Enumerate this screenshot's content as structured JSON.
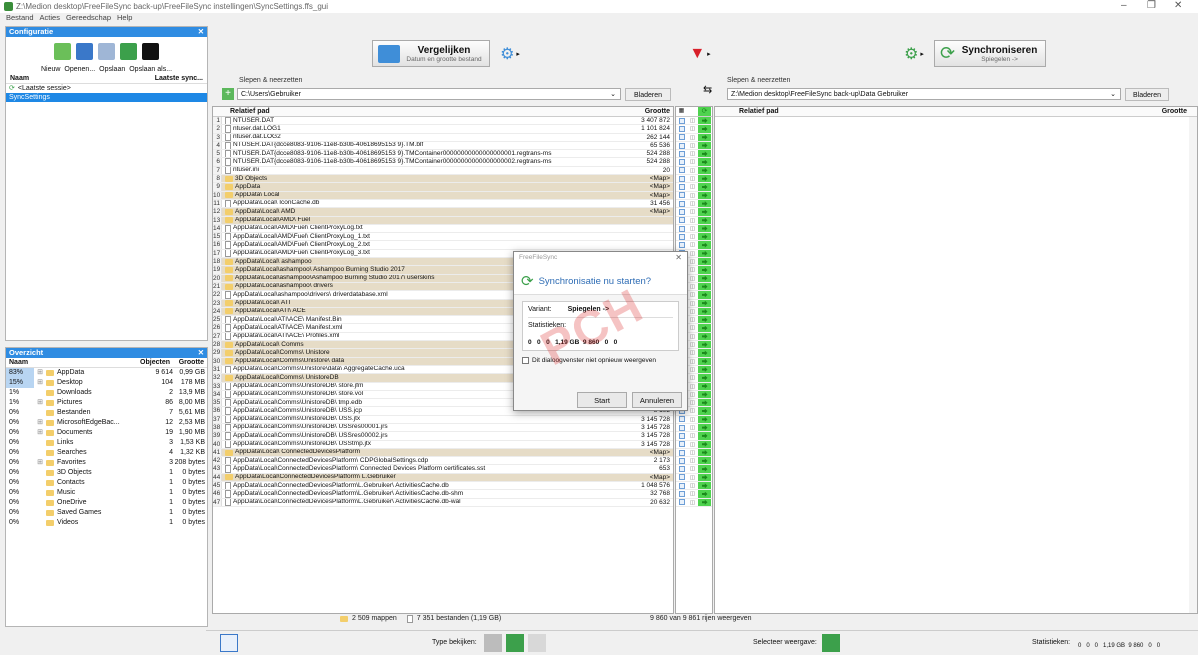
{
  "window": {
    "title": "Z:\\Medion desktop\\FreeFileSync back-up\\FreeFileSync instellingen\\SyncSettings.ffs_gui",
    "minimize": "–",
    "restore": "❐",
    "close": "✕"
  },
  "menu": [
    "Bestand",
    "Acties",
    "Gereedschap",
    "Help"
  ],
  "configuration": {
    "title": "Configuratie",
    "buttons": [
      "Nieuw",
      "Openen...",
      "Opslaan",
      "Opslaan als..."
    ],
    "col_name": "Naam",
    "col_last_sync": "Laatste sync...",
    "items": [
      "<Laatste sessie>",
      "SyncSettings"
    ]
  },
  "overview": {
    "title": "Overzicht",
    "col_name": "Naam",
    "col_objects": "Objecten",
    "col_size": "Grootte",
    "rows": [
      {
        "pct": "83%",
        "expand": "⊞",
        "name": "AppData",
        "objects": "9 614",
        "size": "0,99 GB"
      },
      {
        "pct": "15%",
        "expand": "⊞",
        "name": "Desktop",
        "objects": "104",
        "size": "178 MB"
      },
      {
        "pct": "1%",
        "expand": "",
        "name": "Downloads",
        "objects": "2",
        "size": "13,9 MB"
      },
      {
        "pct": "1%",
        "expand": "⊞",
        "name": "Pictures",
        "objects": "86",
        "size": "8,00 MB"
      },
      {
        "pct": "0%",
        "expand": "",
        "name": "Bestanden",
        "objects": "7",
        "size": "5,61 MB"
      },
      {
        "pct": "0%",
        "expand": "⊞",
        "name": "MicrosoftEdgeBac...",
        "objects": "12",
        "size": "2,53 MB"
      },
      {
        "pct": "0%",
        "expand": "⊞",
        "name": "Documents",
        "objects": "19",
        "size": "1,90 MB"
      },
      {
        "pct": "0%",
        "expand": "",
        "name": "Links",
        "objects": "3",
        "size": "1,53 KB"
      },
      {
        "pct": "0%",
        "expand": "",
        "name": "Searches",
        "objects": "4",
        "size": "1,32 KB"
      },
      {
        "pct": "0%",
        "expand": "⊞",
        "name": "Favorites",
        "objects": "3",
        "size": "208 bytes"
      },
      {
        "pct": "0%",
        "expand": "",
        "name": "3D Objects",
        "objects": "1",
        "size": "0 bytes"
      },
      {
        "pct": "0%",
        "expand": "",
        "name": "Contacts",
        "objects": "1",
        "size": "0 bytes"
      },
      {
        "pct": "0%",
        "expand": "",
        "name": "Music",
        "objects": "1",
        "size": "0 bytes"
      },
      {
        "pct": "0%",
        "expand": "",
        "name": "OneDrive",
        "objects": "1",
        "size": "0 bytes"
      },
      {
        "pct": "0%",
        "expand": "",
        "name": "Saved Games",
        "objects": "1",
        "size": "0 bytes"
      },
      {
        "pct": "0%",
        "expand": "",
        "name": "Videos",
        "objects": "1",
        "size": "0 bytes"
      }
    ]
  },
  "toolbar": {
    "compare_label": "Vergelijken",
    "compare_sub": "Datum en grootte bestand",
    "sync_label": "Synchroniseren",
    "sync_sub": "Spiegelen ->"
  },
  "left": {
    "drag_label": "Slepen & neerzetten",
    "path": "C:\\Users\\Gebruiker",
    "browse": "Bladeren",
    "col_path": "Relatief pad",
    "col_size": "Grootte"
  },
  "right": {
    "drag_label": "Slepen & neerzetten",
    "path": "Z:\\Medion desktop\\FreeFileSync back-up\\Data Gebruiker",
    "browse": "Bladeren",
    "col_path": "Relatief pad",
    "col_size": "Grootte"
  },
  "rows": [
    {
      "n": "1",
      "p": "NTUSER.DAT",
      "s": "3 407 872",
      "f": false
    },
    {
      "n": "2",
      "p": "ntuser.dat.LOG1",
      "s": "1 101 824",
      "f": false
    },
    {
      "n": "3",
      "p": "ntuser.dat.LOG2",
      "s": "262 144",
      "f": false
    },
    {
      "n": "4",
      "p": "NTUSER.DAT{dcce8083-9106-11e8-b30b-40618695153 9}.TM.blf",
      "s": "65 536",
      "f": false
    },
    {
      "n": "5",
      "p": "NTUSER.DAT{dcce8083-9106-11e8-b30b-40618695153 9}.TMContainer00000000000000000001.regtrans-ms",
      "s": "524 288",
      "f": false
    },
    {
      "n": "6",
      "p": "NTUSER.DAT{dcce8083-9106-11e8-b30b-40618695153 9}.TMContainer00000000000000000002.regtrans-ms",
      "s": "524 288",
      "f": false
    },
    {
      "n": "7",
      "p": "ntuser.ini",
      "s": "20",
      "f": false
    },
    {
      "n": "8",
      "p": "3D Objects",
      "s": "<Map>",
      "f": true
    },
    {
      "n": "9",
      "p": "AppData",
      "s": "<Map>",
      "f": true
    },
    {
      "n": "10",
      "p": "AppData\\  Local",
      "s": "<Map>",
      "f": true
    },
    {
      "n": "11",
      "p": "AppData\\Local\\  IconCache.db",
      "s": "31 456",
      "f": false
    },
    {
      "n": "12",
      "p": "AppData\\Local\\  AMD",
      "s": "<Map>",
      "f": true
    },
    {
      "n": "13",
      "p": "AppData\\Local\\AMD\\  Fuel",
      "s": "",
      "f": true
    },
    {
      "n": "14",
      "p": "AppData\\Local\\AMD\\Fuel\\  ClientProxyLog.txt",
      "s": "",
      "f": false
    },
    {
      "n": "15",
      "p": "AppData\\Local\\AMD\\Fuel\\  ClientProxyLog_1.txt",
      "s": "",
      "f": false
    },
    {
      "n": "16",
      "p": "AppData\\Local\\AMD\\Fuel\\  ClientProxyLog_2.txt",
      "s": "",
      "f": false
    },
    {
      "n": "17",
      "p": "AppData\\Local\\AMD\\Fuel\\  ClientProxyLog_3.txt",
      "s": "",
      "f": false
    },
    {
      "n": "18",
      "p": "AppData\\Local\\  ashampoo",
      "s": "",
      "f": true
    },
    {
      "n": "19",
      "p": "AppData\\Local\\ashampoo\\  Ashampoo Burning Studio 2017",
      "s": "",
      "f": true
    },
    {
      "n": "20",
      "p": "AppData\\Local\\ashampoo\\Ashampoo Burning Studio 2017\\  userskins",
      "s": "",
      "f": true
    },
    {
      "n": "21",
      "p": "AppData\\Local\\ashampoo\\  drivers",
      "s": "",
      "f": true
    },
    {
      "n": "22",
      "p": "AppData\\Local\\ashampoo\\drivers\\  driverdatabase.xml",
      "s": "",
      "f": false
    },
    {
      "n": "23",
      "p": "AppData\\Local\\  ATI",
      "s": "",
      "f": true
    },
    {
      "n": "24",
      "p": "AppData\\Local\\ATI\\  ACE",
      "s": "",
      "f": true
    },
    {
      "n": "25",
      "p": "AppData\\Local\\ATI\\ACE\\  Manifest.Bin",
      "s": "",
      "f": false
    },
    {
      "n": "26",
      "p": "AppData\\Local\\ATI\\ACE\\  Manifest.xml",
      "s": "",
      "f": false
    },
    {
      "n": "27",
      "p": "AppData\\Local\\ATI\\ACE\\  Profiles.xml",
      "s": "",
      "f": false
    },
    {
      "n": "28",
      "p": "AppData\\Local\\  Comms",
      "s": "",
      "f": true
    },
    {
      "n": "29",
      "p": "AppData\\Local\\Comms\\  Unistore",
      "s": "<Map>",
      "f": true
    },
    {
      "n": "30",
      "p": "AppData\\Local\\Comms\\Unistore\\  data",
      "s": "<Map>",
      "f": true
    },
    {
      "n": "31",
      "p": "AppData\\Local\\Comms\\Unistore\\data\\  AggregateCache.uca",
      "s": "4",
      "f": false
    },
    {
      "n": "32",
      "p": "AppData\\Local\\Comms\\  UnistoreDB",
      "s": "<Map>",
      "f": true
    },
    {
      "n": "33",
      "p": "AppData\\Local\\Comms\\UnistoreDB\\  store.jfm",
      "s": "16 384",
      "f": false
    },
    {
      "n": "34",
      "p": "AppData\\Local\\Comms\\UnistoreDB\\  store.vol",
      "s": "12 582 912",
      "f": false
    },
    {
      "n": "35",
      "p": "AppData\\Local\\Comms\\UnistoreDB\\  tmp.edb",
      "s": "196 608",
      "f": false
    },
    {
      "n": "36",
      "p": "AppData\\Local\\Comms\\UnistoreDB\\  USS.jcp",
      "s": "8 192",
      "f": false
    },
    {
      "n": "37",
      "p": "AppData\\Local\\Comms\\UnistoreDB\\  USS.jtx",
      "s": "3 145 728",
      "f": false
    },
    {
      "n": "38",
      "p": "AppData\\Local\\Comms\\UnistoreDB\\  USSres00001.jrs",
      "s": "3 145 728",
      "f": false
    },
    {
      "n": "39",
      "p": "AppData\\Local\\Comms\\UnistoreDB\\  USSres00002.jrs",
      "s": "3 145 728",
      "f": false
    },
    {
      "n": "40",
      "p": "AppData\\Local\\Comms\\UnistoreDB\\  USStmp.jtx",
      "s": "3 145 728",
      "f": false
    },
    {
      "n": "41",
      "p": "AppData\\Local\\  ConnectedDevicesPlatform",
      "s": "<Map>",
      "f": true
    },
    {
      "n": "42",
      "p": "AppData\\Local\\ConnectedDevicesPlatform\\  CDPGlobalSettings.cdp",
      "s": "2 173",
      "f": false
    },
    {
      "n": "43",
      "p": "AppData\\Local\\ConnectedDevicesPlatform\\  Connected Devices Platform certificates.sst",
      "s": "653",
      "f": false
    },
    {
      "n": "44",
      "p": "AppData\\Local\\ConnectedDevicesPlatform\\  L.Gebruiker",
      "s": "<Map>",
      "f": true
    },
    {
      "n": "45",
      "p": "AppData\\Local\\ConnectedDevicesPlatform\\L.Gebruiker\\  ActivitiesCache.db",
      "s": "1 048 576",
      "f": false
    },
    {
      "n": "46",
      "p": "AppData\\Local\\ConnectedDevicesPlatform\\L.Gebruiker\\  ActivitiesCache.db-shm",
      "s": "32 768",
      "f": false
    },
    {
      "n": "47",
      "p": "AppData\\Local\\ConnectedDevicesPlatform\\L.Gebruiker\\  ActivitiesCache.db-wal",
      "s": "20 632",
      "f": false
    }
  ],
  "status": {
    "folders": "2 509 mappen",
    "files": "7 351 bestanden (1,19 GB)",
    "rows_shown": "9 860 van 9 861 rijen weergeven"
  },
  "dialog": {
    "title": "FreeFileSync",
    "question": "Synchronisatie nu starten?",
    "variant_label": "Variant:",
    "variant_value": "Spiegelen ->",
    "stats_label": "Statistieken:",
    "stats_values": "0   0   0   1,19 GB  9 860   0   0",
    "checkbox_label": "Dit dialoogvenster niet opnieuw weergeven",
    "start": "Start",
    "cancel": "Annuleren"
  },
  "watermark": "PCH",
  "bottom": {
    "view_type": "Type bekijken:",
    "select_view": "Selecteer weergave:",
    "stats_label": "Statistieken:",
    "stats_values": "0   0   0   1,19 GB  9 860   0   0"
  },
  "colors": {
    "accent": "#2f8ce2",
    "action_green": "#4fd34f",
    "folder_row": "#e6dcc7"
  }
}
